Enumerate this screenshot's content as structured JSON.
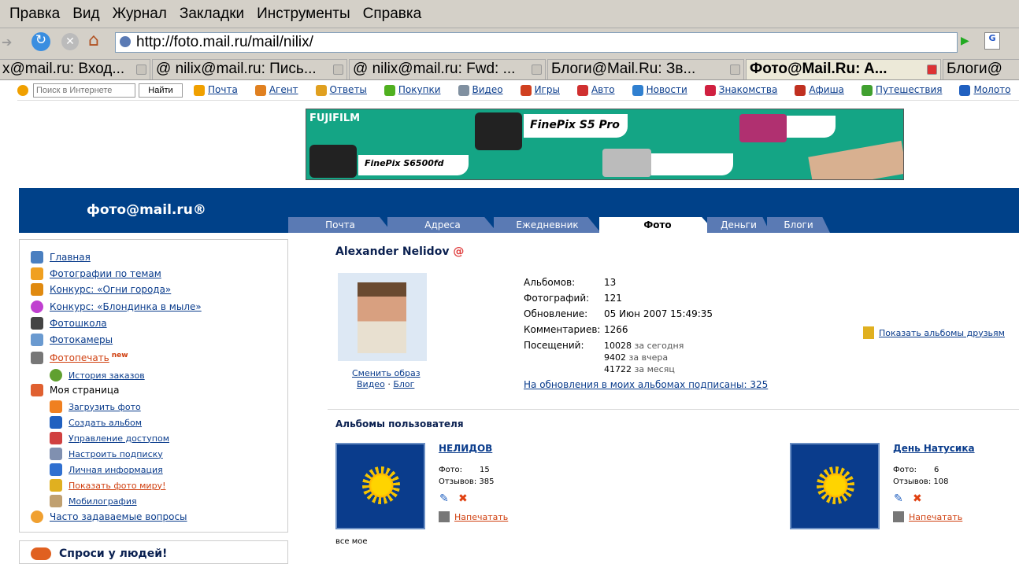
{
  "menu": [
    "Правка",
    "Вид",
    "Журнал",
    "Закладки",
    "Инструменты",
    "Справка"
  ],
  "url": "http://foto.mail.ru/mail/nilix/",
  "browser_tabs": [
    {
      "label": "x@mail.ru: Вход...",
      "active": false
    },
    {
      "label": "@ nilix@mail.ru: Пись...",
      "active": false
    },
    {
      "label": "@ nilix@mail.ru: Fwd: ...",
      "active": false
    },
    {
      "label": "Блоги@Mail.Ru: Зв...",
      "active": false
    },
    {
      "label": "Фото@Mail.Ru: A...",
      "active": true
    },
    {
      "label": "Блоги@",
      "active": false
    }
  ],
  "portal": {
    "search_placeholder": "Поиск в Интернете",
    "search_button": "Найти",
    "links": [
      {
        "label": "Почта",
        "color": "#f0a000"
      },
      {
        "label": "Агент",
        "color": "#e08020"
      },
      {
        "label": "Ответы",
        "color": "#e0a020"
      },
      {
        "label": "Покупки",
        "color": "#50b020"
      },
      {
        "label": "Видео",
        "color": "#8090a0"
      },
      {
        "label": "Игры",
        "color": "#d04020"
      },
      {
        "label": "Авто",
        "color": "#d03030"
      },
      {
        "label": "Новости",
        "color": "#3080d0"
      },
      {
        "label": "Знакомства",
        "color": "#d02040"
      },
      {
        "label": "Афиша",
        "color": "#c03020"
      },
      {
        "label": "Путешествия",
        "color": "#40a030"
      },
      {
        "label": "Молото",
        "color": "#2060c0"
      }
    ]
  },
  "banner": {
    "brand": "FUJIFILM",
    "model1": "FinePix S5 Pro",
    "model2": "FinePix S6500fd"
  },
  "logo": "фото@mail.ru®",
  "service_tabs": [
    "Почта",
    "Адреса",
    "Ежедневник",
    "Фото",
    "Деньги",
    "Блоги"
  ],
  "sidebar": {
    "items": [
      "Главная",
      "Фотографии по темам",
      "Конкурс: «Огни города»",
      "Конкурс: «Блондинка в мыле»",
      "Фотошкола",
      "Фотокамеры",
      "Фотопечать"
    ],
    "new_badge": "new",
    "history": "История заказов",
    "my_page": "Моя страница",
    "sub": [
      "Загрузить фото",
      "Создать альбом",
      "Управление доступом",
      "Настроить подписку",
      "Личная информация",
      "Показать фото миру!",
      "Мобилография"
    ],
    "faq": "Часто задаваемые вопросы",
    "ask": "Спроси у людей!"
  },
  "profile": {
    "name": "Alexander Nelidov",
    "change": "Сменить образ",
    "video": "Видео",
    "sep": "·",
    "blog": "Блог",
    "stats": [
      {
        "label": "Альбомов:",
        "value": "13"
      },
      {
        "label": "Фотографий:",
        "value": "121"
      },
      {
        "label": "Обновление:",
        "value": "05 Июн 2007 15:49:35"
      },
      {
        "label": "Комментариев:",
        "value": "1266"
      },
      {
        "label": "Посещений:",
        "value": "10028"
      }
    ],
    "visits": [
      {
        "n": "10028",
        "t": "за сегодня"
      },
      {
        "n": "9402",
        "t": "за вчера"
      },
      {
        "n": "41722",
        "t": "за месяц"
      }
    ],
    "subscribed": "На обновления в моих альбомах подписаны: 325",
    "show_friends": "Показать альбомы друзьям"
  },
  "albums": {
    "title": "Альбомы пользователя",
    "items": [
      {
        "name": "НЕЛИДОВ",
        "photo_label": "Фото:",
        "photos": "15",
        "rev_label": "Отзывов:",
        "reviews": "385",
        "print": "Напечатать"
      },
      {
        "name": "День Натусика",
        "photo_label": "Фото:",
        "photos": "6",
        "rev_label": "Отзывов:",
        "reviews": "108",
        "print": "Напечатать"
      }
    ],
    "footer": "все мое"
  }
}
